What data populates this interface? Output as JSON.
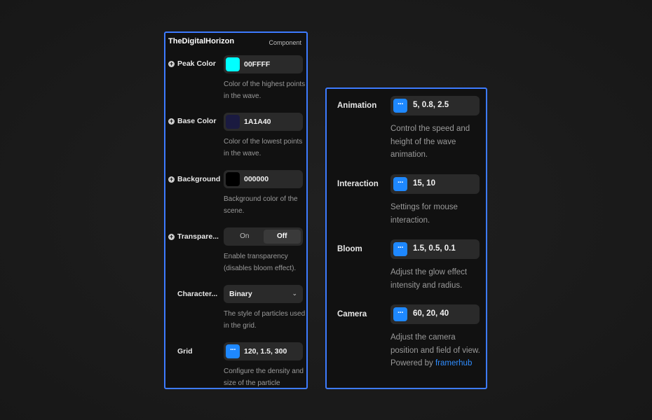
{
  "left_panel": {
    "title": "TheDigitalHorizon",
    "tag": "Component",
    "peak_color": {
      "label": "Peak Color",
      "value": "00FFFF",
      "color": "#00FFFF",
      "description": "Color of the highest points in the wave."
    },
    "base_color": {
      "label": "Base Color",
      "value": "1A1A40",
      "color": "#1A1A40",
      "description": "Color of the lowest points in the wave."
    },
    "background": {
      "label": "Background",
      "value": "000000",
      "color": "#000000",
      "description": "Background color of the scene."
    },
    "transparency": {
      "label": "Transpare...",
      "on_label": "On",
      "off_label": "Off",
      "selected": "Off",
      "description": "Enable transparency (disables bloom effect)."
    },
    "character": {
      "label": "Character...",
      "value": "Binary",
      "description": "The style of particles used in the grid."
    },
    "grid": {
      "label": "Grid",
      "value": "120, 1.5, 300",
      "description": "Configure the density and size of the particle"
    }
  },
  "right_panel": {
    "animation": {
      "label": "Animation",
      "value": "5, 0.8, 2.5",
      "description": "Control the speed and height of the wave animation."
    },
    "interaction": {
      "label": "Interaction",
      "value": "15, 10",
      "description": "Settings for mouse interaction."
    },
    "bloom": {
      "label": "Bloom",
      "value": "1.5, 0.5, 0.1",
      "description": "Adjust the glow effect intensity and radius."
    },
    "camera": {
      "label": "Camera",
      "value": "60, 20, 40",
      "description": "Adjust the camera position and field of view. Powered by",
      "link": "framerhub"
    }
  },
  "colors": {
    "accent": "#3D7BFF",
    "button": "#1E88FF",
    "link": "#2F8DFF"
  },
  "icons": {
    "expand": "plus-circle-icon",
    "more": "ellipsis-icon",
    "dropdown": "chevron-down-icon"
  }
}
